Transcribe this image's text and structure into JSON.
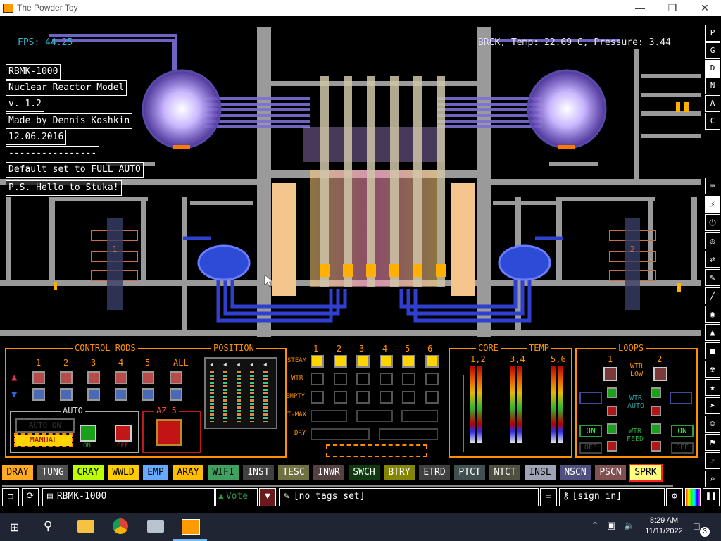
{
  "window": {
    "title": "The Powder Toy"
  },
  "hud": {
    "fps": "FPS: 44.25",
    "status": "BRCK, Temp: 22.69 C, Pressure: 3.44"
  },
  "info_lines": [
    "RBMK-1000",
    "Nuclear Reactor Model",
    "v. 1.2",
    "Made by Dennis Koshkin",
    "12.06.2016",
    "----------------",
    "Default set to FULL AUTO",
    "P.S. Hello to Stuka!"
  ],
  "reactor": {
    "loop_label_left": "1",
    "loop_label_right": "2"
  },
  "panels": {
    "control_rods": "CONTROL RODS",
    "position": "POSITION",
    "core": "CORE",
    "temp": "TEMP",
    "loops": "LOOPS",
    "rod_numbers": [
      "1",
      "2",
      "3",
      "4",
      "5",
      "ALL"
    ],
    "auto": "AUTO",
    "auto_on": "AUTO ON",
    "manual": "MANUAL",
    "on_small": "ON",
    "off_small": "OFF",
    "az5": "AZ-5",
    "channel_numbers": [
      "1",
      "2",
      "3",
      "4",
      "5",
      "6"
    ],
    "row_labels": [
      "STEAM",
      "WTR",
      "EMPTY",
      "T-MAX",
      "DRY"
    ],
    "core_labels": [
      "1,2",
      "3,4",
      "5,6"
    ],
    "loop_numbers": [
      "1",
      "2"
    ],
    "wtr_low": "WTR LOW",
    "wtr_auto": "WTR AUTO",
    "wtr_feed": "WTR FEED",
    "on": "ON",
    "off": "OFF"
  },
  "right_tools": [
    "P",
    "G",
    "D",
    "N",
    "A",
    "C"
  ],
  "right_icons": [
    "keyboard-icon",
    "plug-icon",
    "power-icon",
    "lock-icon",
    "arrows-icon",
    "brush-icon",
    "pen-icon",
    "drop-icon",
    "triangle-icon",
    "square-icon",
    "radiation-icon",
    "star-icon",
    "cursor-icon",
    "person-icon",
    "bookmark-icon",
    "pointer-icon",
    "magnifier-icon"
  ],
  "toolbar": [
    {
      "label": "DRAY",
      "bg": "#ffaa22",
      "fg": "#000"
    },
    {
      "label": "TUNG",
      "bg": "#505050",
      "fg": "#fff"
    },
    {
      "label": "CRAY",
      "bg": "#bbff00",
      "fg": "#000"
    },
    {
      "label": "WWLD",
      "bg": "#ffcc00",
      "fg": "#000"
    },
    {
      "label": "EMP",
      "bg": "#66aaff",
      "fg": "#000"
    },
    {
      "label": "ARAY",
      "bg": "#ffbb00",
      "fg": "#000"
    },
    {
      "label": "WIFI",
      "bg": "#40a060",
      "fg": "#000"
    },
    {
      "label": "INST",
      "bg": "#404040",
      "fg": "#fff"
    },
    {
      "label": "TESC",
      "bg": "#707040",
      "fg": "#fff"
    },
    {
      "label": "INWR",
      "bg": "#544141",
      "fg": "#fff"
    },
    {
      "label": "SWCH",
      "bg": "#103b11",
      "fg": "#fff"
    },
    {
      "label": "BTRY",
      "bg": "#858505",
      "fg": "#fff"
    },
    {
      "label": "ETRD",
      "bg": "#404040",
      "fg": "#fff"
    },
    {
      "label": "PTCT",
      "bg": "#405050",
      "fg": "#fff"
    },
    {
      "label": "NTCT",
      "bg": "#505040",
      "fg": "#fff"
    },
    {
      "label": "INSL",
      "bg": "#9ea3b6",
      "fg": "#000"
    },
    {
      "label": "NSCN",
      "bg": "#505080",
      "fg": "#fff"
    },
    {
      "label": "PSCN",
      "bg": "#805050",
      "fg": "#fff"
    },
    {
      "label": "SPRK",
      "bg": "#ffff80",
      "fg": "#000"
    }
  ],
  "bottom_bar": {
    "save_name": "RBMK-1000",
    "vote": "Vote",
    "tags": "[no tags set]",
    "sign_in": "[sign in]"
  },
  "taskbar": {
    "time": "8:29 AM",
    "date": "11/11/2022",
    "notification_count": "3"
  }
}
